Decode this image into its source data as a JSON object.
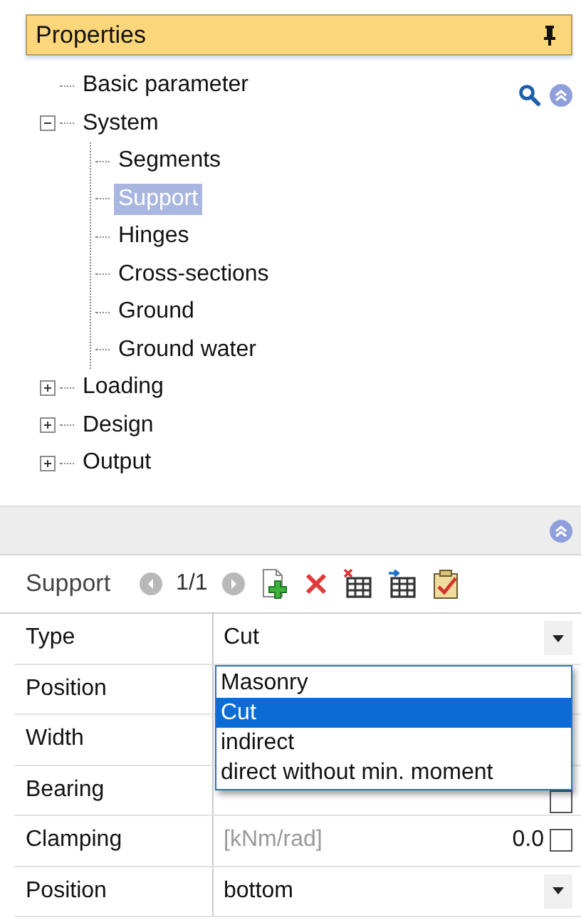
{
  "panel": {
    "title": "Properties"
  },
  "tree": [
    {
      "label": "Basic parameter",
      "selected": false
    },
    {
      "label": "System",
      "selected": false,
      "expanded": true,
      "children": [
        {
          "label": "Segments",
          "selected": false
        },
        {
          "label": "Support",
          "selected": true
        },
        {
          "label": "Hinges",
          "selected": false
        },
        {
          "label": "Cross-sections",
          "selected": false
        },
        {
          "label": "Ground",
          "selected": false
        },
        {
          "label": "Ground water",
          "selected": false
        }
      ]
    },
    {
      "label": "Loading",
      "selected": false,
      "expanded": false
    },
    {
      "label": "Design",
      "selected": false,
      "expanded": false
    },
    {
      "label": "Output",
      "selected": false,
      "expanded": false
    }
  ],
  "editor": {
    "title": "Support",
    "counter": "1/1",
    "rows": [
      {
        "label": "Type",
        "kind": "dropdown",
        "value": "Cut"
      },
      {
        "label": "Position",
        "kind": "blank"
      },
      {
        "label": "Width",
        "kind": "blank"
      },
      {
        "label": "Bearing",
        "kind": "checkbox",
        "checked": false
      },
      {
        "label": "Clamping",
        "kind": "number",
        "unit": "[kNm/rad]",
        "value": "0.0",
        "checked": false
      },
      {
        "label": "Position",
        "kind": "dropdown",
        "value": "bottom"
      }
    ],
    "dropdown": {
      "options": [
        {
          "label": "Masonry",
          "selected": false
        },
        {
          "label": "Cut",
          "selected": true
        },
        {
          "label": "indirect",
          "selected": false
        },
        {
          "label": "direct without min. moment",
          "selected": false
        }
      ]
    }
  }
}
